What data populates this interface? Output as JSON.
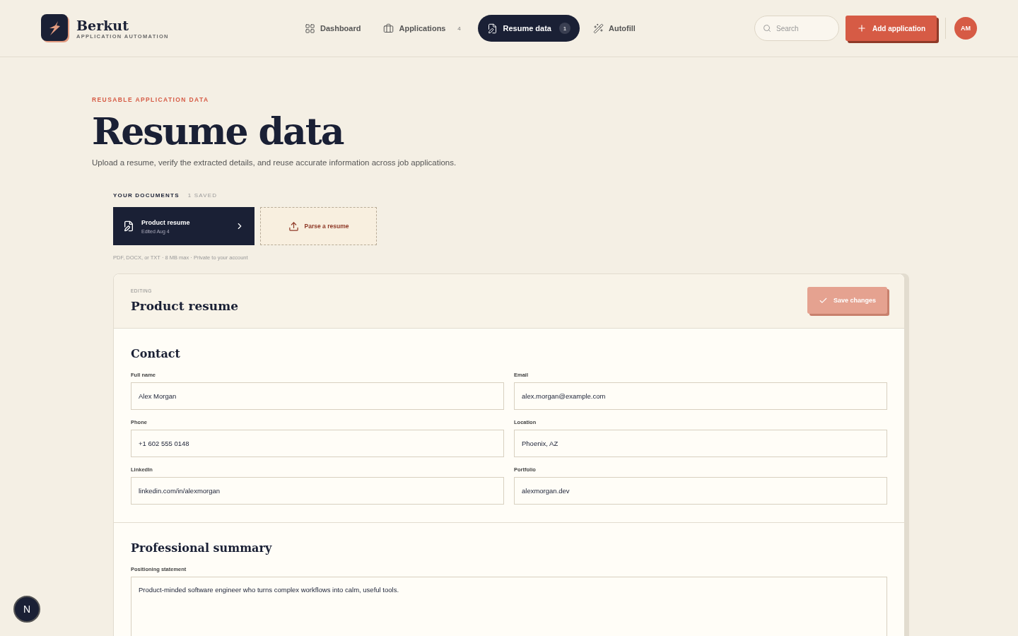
{
  "brand": {
    "name": "Berkut",
    "tagline": "APPLICATION AUTOMATION"
  },
  "nav": [
    {
      "label": "Dashboard",
      "selected": false
    },
    {
      "label": "Applications",
      "count": "4",
      "selected": false
    },
    {
      "label": "Resume data",
      "count": "1",
      "selected": true
    },
    {
      "label": "Autofill",
      "selected": false
    }
  ],
  "search": {
    "placeholder": "Search"
  },
  "add_button": "Add application",
  "avatar": "AM",
  "eyebrow": "REUSABLE APPLICATION DATA",
  "title": "Resume data",
  "subtitle": "Upload a resume, verify the extracted details, and reuse accurate information across job applications.",
  "documents": {
    "heading": "YOUR DOCUMENTS",
    "count": "1 SAVED",
    "items": [
      {
        "name": "Product resume",
        "meta": "Edited Aug 4",
        "selected": true
      }
    ],
    "upload": "Parse a resume",
    "note": "PDF, DOCX, or TXT · 8 MB max · Private to your account"
  },
  "editor": {
    "eyebrow": "EDITING",
    "title": "Product resume",
    "save": "Save changes",
    "save_disabled": true,
    "sections": [
      {
        "title": "Contact",
        "fields": [
          {
            "label": "Full name",
            "value": "Alex Morgan"
          },
          {
            "label": "Email",
            "value": "alex.morgan@example.com"
          },
          {
            "label": "Phone",
            "value": "+1 602 555 0148"
          },
          {
            "label": "Location",
            "value": "Phoenix, AZ"
          },
          {
            "label": "LinkedIn",
            "value": "linkedin.com/in/alexmorgan"
          },
          {
            "label": "Portfolio",
            "value": "alexmorgan.dev"
          }
        ]
      },
      {
        "title": "Professional summary",
        "fields": [
          {
            "label": "Positioning statement",
            "value": "Product-minded software engineer who turns complex workflows into calm, useful tools.",
            "kind": "textarea"
          }
        ]
      }
    ]
  },
  "dev_indicator": "N"
}
